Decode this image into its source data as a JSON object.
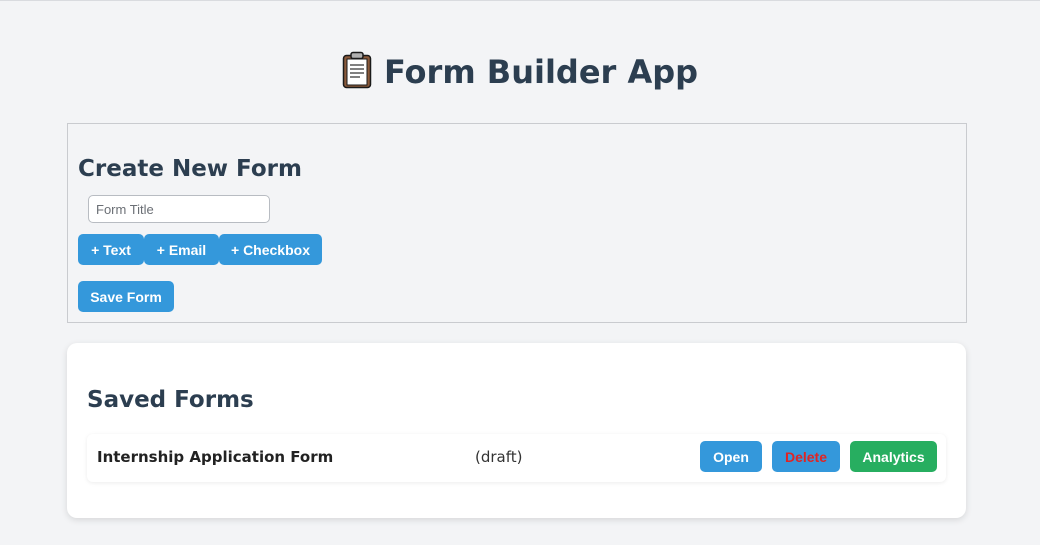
{
  "app": {
    "title": "Form Builder App",
    "title_icon": "clipboard-icon"
  },
  "create_form": {
    "heading": "Create New Form",
    "title_input": {
      "placeholder": "Form Title",
      "value": ""
    },
    "buttons": {
      "add_text": "+ Text",
      "add_email": "+ Email",
      "add_checkbox": "+ Checkbox",
      "save": "Save Form"
    }
  },
  "saved_forms": {
    "heading": "Saved Forms",
    "items": [
      {
        "name": "Internship Application Form",
        "status": "(draft)",
        "actions": {
          "open": "Open",
          "delete": "Delete",
          "analytics": "Analytics"
        }
      }
    ]
  },
  "colors": {
    "primary": "#3498db",
    "success": "#27ae60",
    "danger_text": "#e02424",
    "heading": "#2c3e50"
  }
}
